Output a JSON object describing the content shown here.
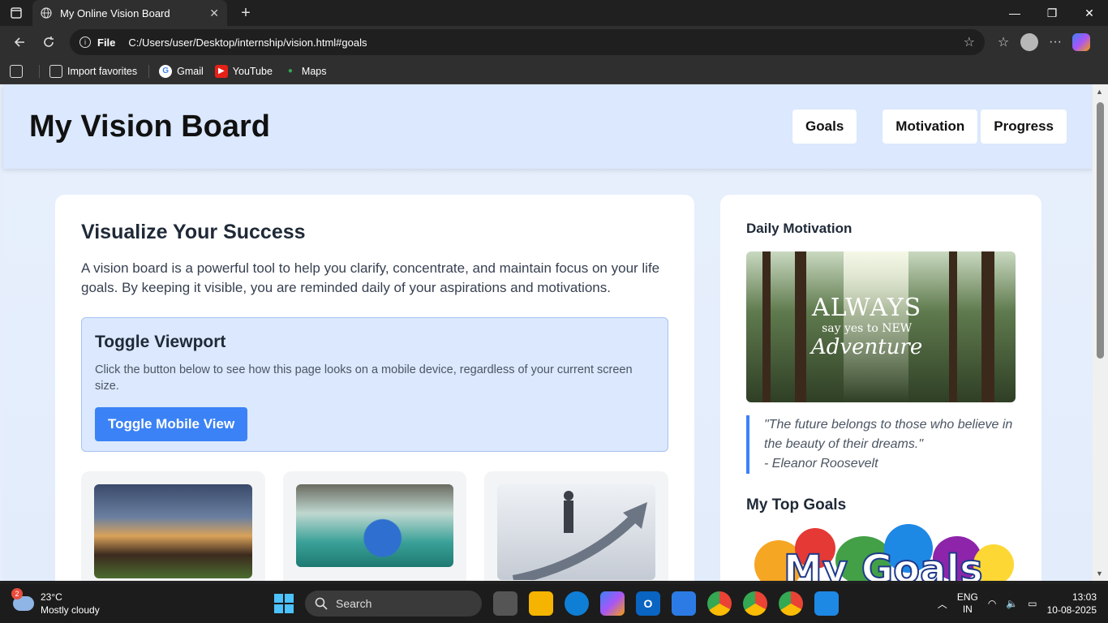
{
  "browser": {
    "tab_title": "My Online Vision Board",
    "file_label": "File",
    "url": "C:/Users/user/Desktop/internship/vision.html#goals",
    "favorites": [
      {
        "label": "Import favorites"
      },
      {
        "label": "Gmail"
      },
      {
        "label": "YouTube"
      },
      {
        "label": "Maps"
      }
    ]
  },
  "site": {
    "title": "My Vision Board",
    "nav": [
      "Goals",
      "Motivation",
      "Progress"
    ]
  },
  "main": {
    "heading": "Visualize Your Success",
    "intro": "A vision board is a powerful tool to help you clarify, concentrate, and maintain focus on your life goals. By keeping it visible, you are reminded daily of your aspirations and motivations.",
    "toggle": {
      "heading": "Toggle Viewport",
      "text": "Click the button below to see how this page looks on a mobile device, regardless of your current screen size.",
      "button": "Toggle Mobile View"
    }
  },
  "side": {
    "motivation_heading": "Daily Motivation",
    "image_words": [
      "ALWAYS",
      "say yes to NEW",
      "Adventure"
    ],
    "quote": "\"The future belongs to those who believe in the beauty of their dreams.\"",
    "quote_author": "- Eleanor Roosevelt",
    "goals_heading": "My Top Goals",
    "goals_image_text": "My Goals"
  },
  "taskbar": {
    "weather_badge": "2",
    "temperature": "23°C",
    "condition": "Mostly cloudy",
    "search": "Search",
    "lang_1": "ENG",
    "lang_2": "IN",
    "time": "13:03",
    "date": "10-08-2025"
  },
  "colors": {
    "accent": "#3b82f6",
    "header_bg": "#dbe8fd",
    "page_bg": "#e6eefb"
  }
}
